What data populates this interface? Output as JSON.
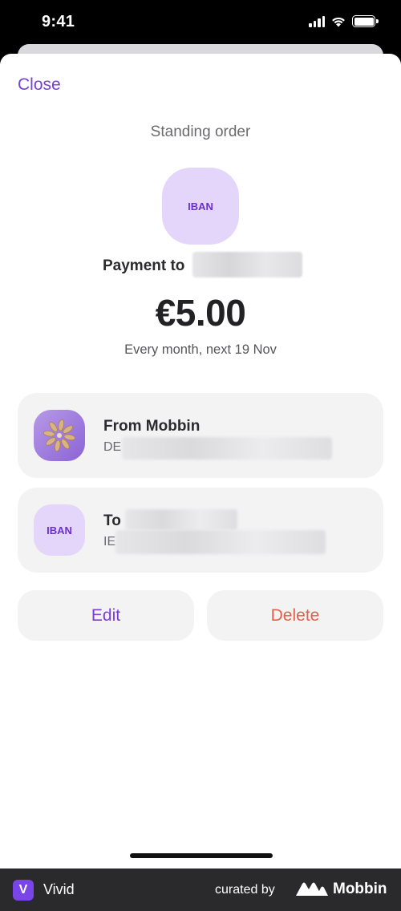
{
  "status_bar": {
    "time": "9:41"
  },
  "sheet": {
    "close_label": "Close",
    "title": "Standing order"
  },
  "payment": {
    "icon_label": "IBAN",
    "payment_to_label": "Payment to",
    "amount": "€5.00",
    "schedule": "Every month, next 19 Nov"
  },
  "from_account": {
    "title": "From Mobbin",
    "iban_prefix": "DE"
  },
  "to_account": {
    "icon_label": "IBAN",
    "title_prefix": "To",
    "iban_prefix": "IE"
  },
  "actions": {
    "edit_label": "Edit",
    "delete_label": "Delete"
  },
  "footer": {
    "app_logo_letter": "V",
    "app_name": "Vivid",
    "curated_by": "curated by",
    "brand": "Mobbin"
  },
  "colors": {
    "accent": "#7a3fd6",
    "danger": "#e5604b",
    "iban_bg": "#e4d6fb",
    "card_bg": "#f3f3f4"
  }
}
